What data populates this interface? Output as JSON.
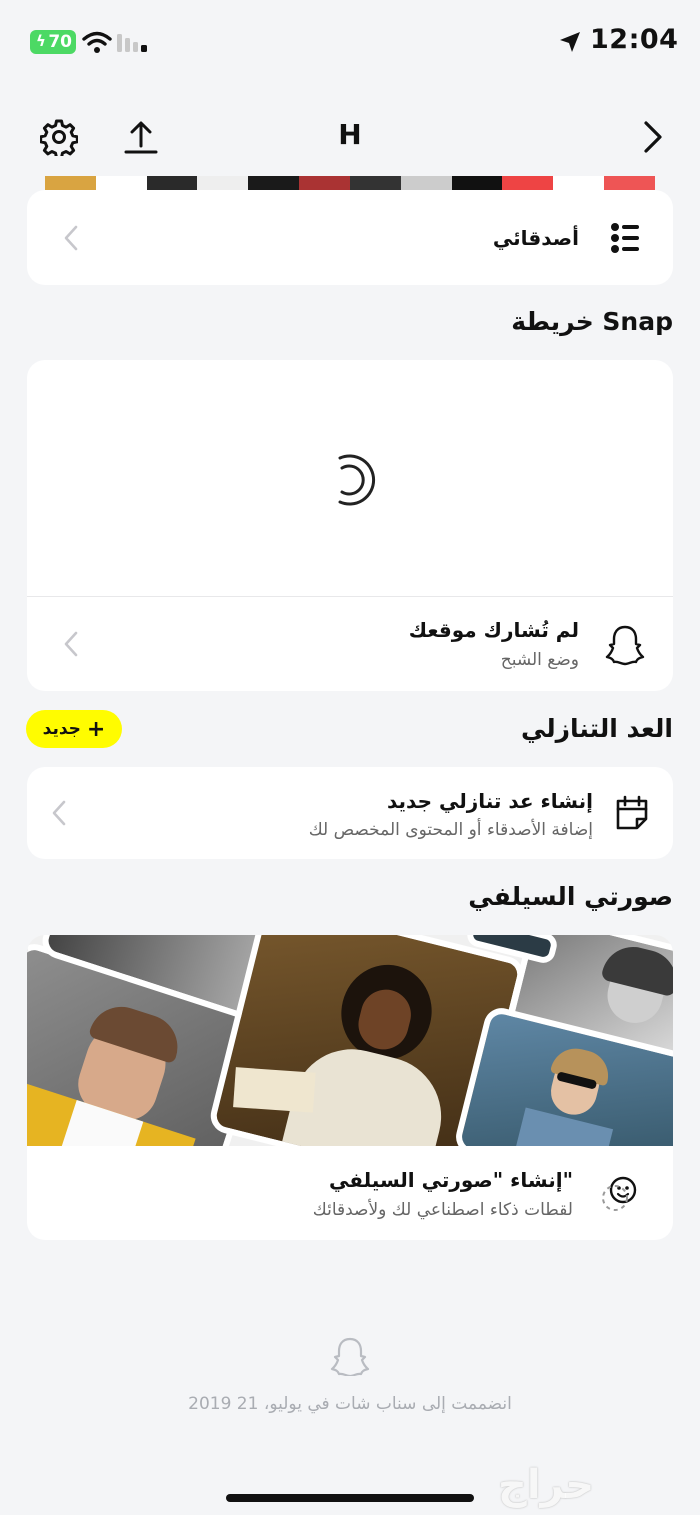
{
  "status_bar": {
    "battery": "70",
    "time": "12:04"
  },
  "nav": {
    "title": "H",
    "icons": [
      "gear-icon",
      "share-upload-icon",
      "chevron-right-icon"
    ]
  },
  "friends_card": {
    "label": "أصدقائي"
  },
  "snap_map": {
    "section_title": "خريطة Snap",
    "row_title": "لم تُشارك موقعك",
    "row_sub": "وضع الشبح"
  },
  "countdown": {
    "section_title": "العد التنازلي",
    "new_label": "جديد",
    "row_title": "إنشاء عد تنازلي جديد",
    "row_sub": "إضافة الأصدقاء أو المحتوى المخصص لك"
  },
  "selfie": {
    "section_title": "صورتي السيلفي",
    "row_title": "إنشاء \"صورتي السيلفي\"",
    "row_sub": "لقطات ذكاء اصطناعي لك ولأصدقائك"
  },
  "footer": {
    "joined": "انضممت إلى سناب شات في يوليو، 21 2019"
  },
  "watermark": "حراج",
  "colors": {
    "background": "#f4f5f7",
    "card": "#ffffff",
    "accent_yellow": "#fffc00",
    "battery_green": "#4cd964"
  }
}
